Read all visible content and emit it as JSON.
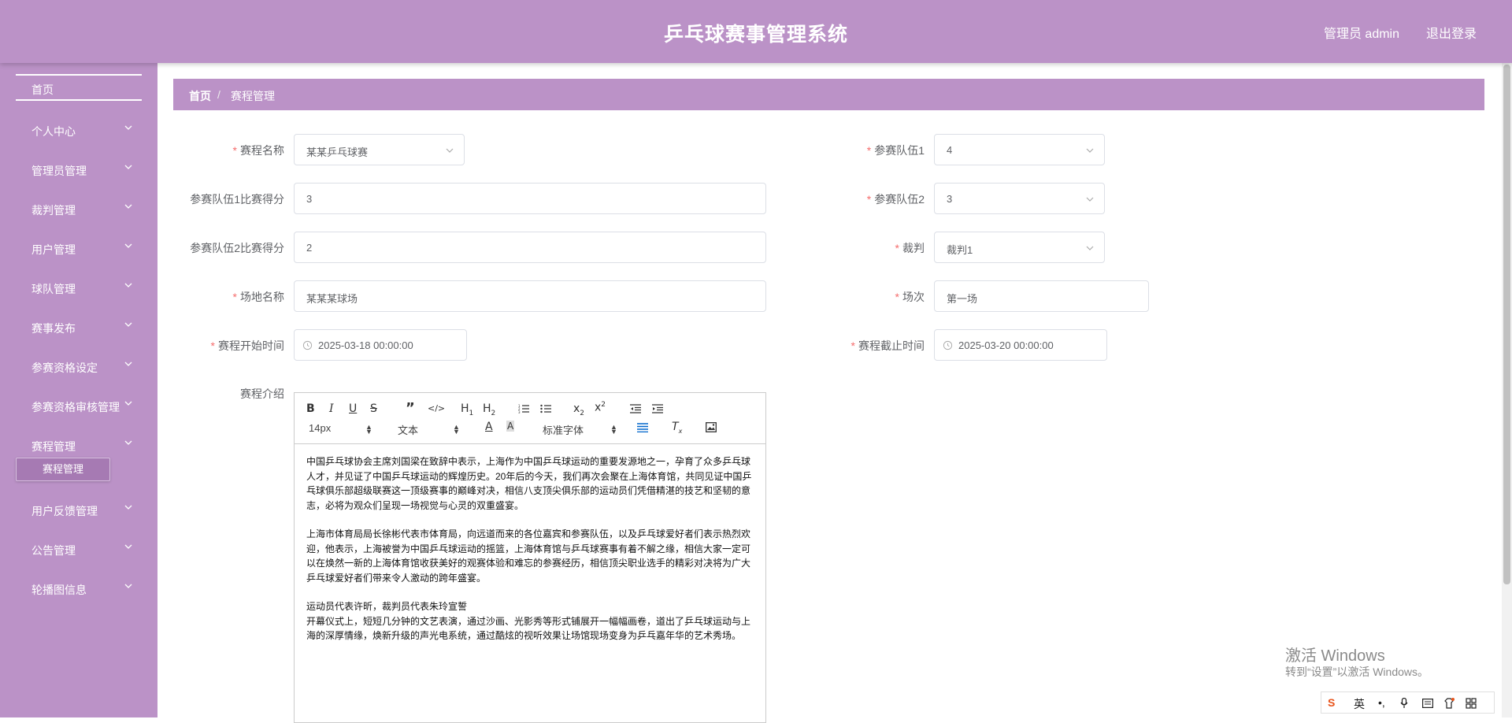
{
  "header": {
    "title": "乒乓球赛事管理系统",
    "user": "管理员 admin",
    "logout": "退出登录"
  },
  "sidebar": {
    "home": "首页",
    "items": [
      "个人中心",
      "管理员管理",
      "裁判管理",
      "用户管理",
      "球队管理",
      "赛事发布",
      "参赛资格设定",
      "参赛资格审核管理",
      "赛程管理",
      "用户反馈管理",
      "公告管理",
      "轮播图信息"
    ],
    "active_sub": "赛程管理"
  },
  "breadcrumb": {
    "home": "首页",
    "sep": "/",
    "current": "赛程管理"
  },
  "form": {
    "match_name": {
      "label": "赛程名称",
      "value": "某某乒乓球赛"
    },
    "team1": {
      "label": "参赛队伍1",
      "value": "4"
    },
    "team1_score": {
      "label": "参赛队伍1比赛得分",
      "value": "3"
    },
    "team2": {
      "label": "参赛队伍2",
      "value": "3"
    },
    "team2_score": {
      "label": "参赛队伍2比赛得分",
      "value": "2"
    },
    "referee": {
      "label": "裁判",
      "value": "裁判1"
    },
    "venue": {
      "label": "场地名称",
      "value": "某某某球场"
    },
    "round": {
      "label": "场次",
      "value": "第一场"
    },
    "start_time": {
      "label": "赛程开始时间",
      "value": "2025-03-18 00:00:00"
    },
    "end_time": {
      "label": "赛程截止时间",
      "value": "2025-03-20 00:00:00"
    },
    "intro": {
      "label": "赛程介绍"
    }
  },
  "editor": {
    "font_size": "14px",
    "block_type": "文本",
    "font_family": "标准字体",
    "paragraphs": [
      "中国乒乓球协会主席刘国梁在致辞中表示，上海作为中国乒乓球运动的重要发源地之一，孕育了众多乒乓球人才，并见证了中国乒乓球运动的辉煌历史。20年后的今天，我们再次会聚在上海体育馆，共同见证中国乒乓球俱乐部超级联赛这一顶级赛事的巅峰对决，相信八支顶尖俱乐部的运动员们凭借精湛的技艺和坚韧的意志，必将为观众们呈现一场视觉与心灵的双重盛宴。",
      "上海市体育局局长徐彬代表市体育局，向远道而来的各位嘉宾和参赛队伍，以及乒乓球爱好者们表示热烈欢迎，他表示，上海被誉为中国乒乓球运动的摇篮，上海体育馆与乒乓球赛事有着不解之缘，相信大家一定可以在焕然一新的上海体育馆收获美好的观赛体验和难忘的参赛经历，相信顶尖职业选手的精彩对决将为广大乒乓球爱好者们带来令人激动的跨年盛宴。",
      "运动员代表许昕，裁判员代表朱玲宣誓",
      "开幕仪式上，短短几分钟的文艺表演，通过沙画、光影秀等形式铺展开一幅幅画卷，道出了乒乓球运动与上海的深厚情缘，焕新升级的声光电系统，通过酷炫的视听效果让场馆现场变身为乒乓嘉年华的艺术秀场。"
    ]
  },
  "system": {
    "watermark_title": "激活 Windows",
    "watermark_sub": "转到“设置”以激活 Windows。",
    "ime_lang": "英"
  }
}
